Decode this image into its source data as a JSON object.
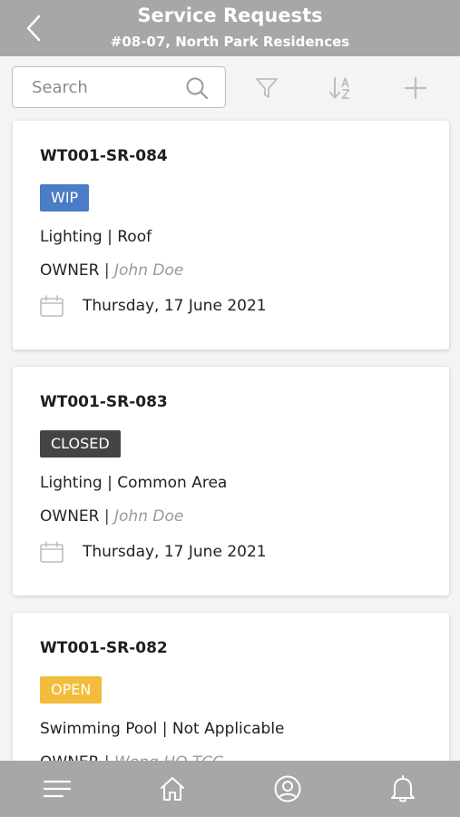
{
  "header": {
    "title": "Service Requests",
    "subtitle": "#08-07, North Park Residences"
  },
  "toolbar": {
    "search_placeholder": "Search"
  },
  "colors": {
    "header_bg": "#a8a6a6",
    "status_wip": "#4a7cc7",
    "status_closed": "#444444",
    "status_open": "#f2bd3c"
  },
  "requests": [
    {
      "id": "WT001-SR-084",
      "status": "WIP",
      "category": "Lighting | Roof",
      "owner_label": "OWNER",
      "owner_sep": "|",
      "owner_name": "John Doe",
      "date": "Thursday, 17 June 2021"
    },
    {
      "id": "WT001-SR-083",
      "status": "CLOSED",
      "category": "Lighting | Common Area",
      "owner_label": "OWNER",
      "owner_sep": "|",
      "owner_name": "John Doe",
      "date": "Thursday, 17 June 2021"
    },
    {
      "id": "WT001-SR-082",
      "status": "OPEN",
      "category": "Swimming Pool | Not Applicable",
      "owner_label": "OWNER",
      "owner_sep": "|",
      "owner_name": "Wong HQ TCC"
    }
  ],
  "bottom_nav": {
    "icons": [
      "menu-icon",
      "home-icon",
      "profile-icon",
      "bell-icon"
    ]
  }
}
